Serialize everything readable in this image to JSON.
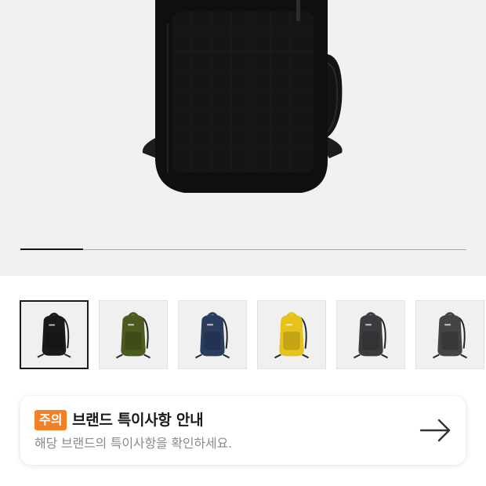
{
  "gallery": {
    "current_index": 0,
    "total": 6,
    "progress_fraction": 0.14
  },
  "thumbnails": [
    {
      "color_name": "black",
      "color": "#1a1a1a",
      "selected": true
    },
    {
      "color_name": "olive",
      "color": "#4b5a1e",
      "selected": false
    },
    {
      "color_name": "navy",
      "color": "#2a3d5e",
      "selected": false
    },
    {
      "color_name": "yellow",
      "color": "#e6c21a",
      "selected": false
    },
    {
      "color_name": "charcoal",
      "color": "#3c3c40",
      "selected": false
    },
    {
      "color_name": "dark-gray",
      "color": "#444447",
      "selected": false
    }
  ],
  "notice": {
    "badge": "주의",
    "title": "브랜드 특이사항 안내",
    "description": "해당 브랜드의 특이사항을 확인하세요.",
    "icon": "arrow-right-icon"
  },
  "colors": {
    "badge_bg": "#f47f25",
    "hero_bg": "#f1f1f1"
  }
}
